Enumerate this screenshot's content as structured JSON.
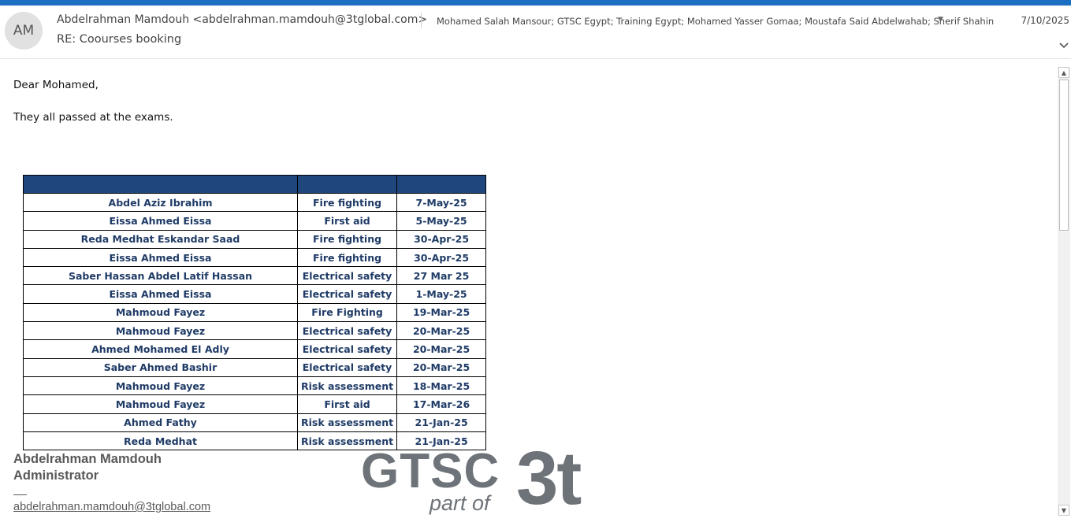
{
  "email": {
    "avatar_initials": "AM",
    "sender": "Abdelrahman Mamdouh <abdelrahman.mamdouh@3tglobal.com>",
    "recipients": "Mohamed Salah Mansour; GTSC Egypt; Training Egypt; Mohamed Yasser Gomaa; Moustafa Said Abdelwahab; Sherif Shahin",
    "date": "7/10/2025",
    "subject": "RE: Coourses booking",
    "greeting": "Dear Mohamed,",
    "body_line": "They all passed at the exams."
  },
  "table": {
    "header_color": "#1f477d",
    "rows": [
      {
        "name": "Abdel Aziz Ibrahim",
        "course": "Fire fighting",
        "date": "7-May-25"
      },
      {
        "name": "Eissa Ahmed Eissa",
        "course": "First aid",
        "date": "5-May-25"
      },
      {
        "name": "Reda Medhat Eskandar Saad",
        "course": "Fire fighting",
        "date": "30-Apr-25"
      },
      {
        "name": "Eissa Ahmed Eissa",
        "course": "Fire fighting",
        "date": "30-Apr-25"
      },
      {
        "name": "Saber Hassan Abdel Latif Hassan",
        "course": "Electrical safety",
        "date": "27 Mar 25"
      },
      {
        "name": "Eissa Ahmed Eissa",
        "course": "Electrical safety",
        "date": "1-May-25"
      },
      {
        "name": "Mahmoud Fayez",
        "course": "Fire Fighting",
        "date": "19-Mar-25"
      },
      {
        "name": "Mahmoud Fayez",
        "course": "Electrical safety",
        "date": "20-Mar-25"
      },
      {
        "name": "Ahmed Mohamed El Adly",
        "course": "Electrical safety",
        "date": "20-Mar-25"
      },
      {
        "name": "Saber Ahmed Bashir",
        "course": "Electrical safety",
        "date": "20-Mar-25"
      },
      {
        "name": "Mahmoud Fayez",
        "course": "Risk assessment",
        "date": "18-Mar-25"
      },
      {
        "name": "Mahmoud Fayez",
        "course": "First aid",
        "date": "17-Mar-26"
      },
      {
        "name": "Ahmed Fathy",
        "course": "Risk assessment",
        "date": "21-Jan-25"
      },
      {
        "name": "Reda Medhat",
        "course": "Risk assessment",
        "date": "21-Jan-25"
      }
    ]
  },
  "signature": {
    "name": "Abdelrahman Mamdouh",
    "role": "Administrator",
    "email": "abdelrahman.mamdouh@3tglobal.com",
    "logo_text_main": "GTSC",
    "logo_text_sub": "part of",
    "logo_text_brand": "3t"
  },
  "colors": {
    "accent_bar": "#1b6ec2",
    "table_text": "#1f3b66",
    "signature_gray": "#595959"
  },
  "icons": {
    "expand": "chevron-down-icon",
    "recipients_more": "caret-down-icon",
    "scroll_up": "scroll-up-arrow-icon",
    "scroll_down": "scroll-down-arrow-icon"
  }
}
